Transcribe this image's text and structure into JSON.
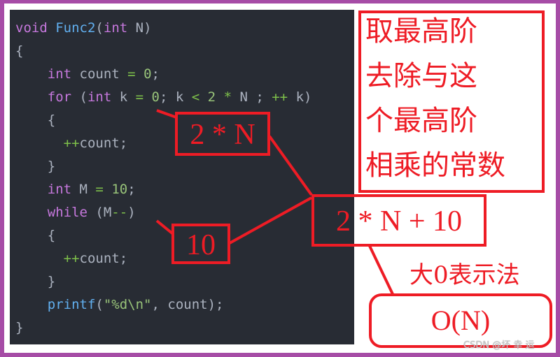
{
  "code": {
    "lines": [
      [
        {
          "t": "void",
          "c": "kw"
        },
        {
          "t": " "
        },
        {
          "t": "Func2",
          "c": "fn"
        },
        {
          "t": "("
        },
        {
          "t": "int",
          "c": "kw"
        },
        {
          "t": " N)"
        }
      ],
      [
        {
          "t": "{"
        }
      ],
      [
        {
          "t": "    "
        },
        {
          "t": "int",
          "c": "kw"
        },
        {
          "t": " count "
        },
        {
          "t": "=",
          "c": "op"
        },
        {
          "t": " "
        },
        {
          "t": "0",
          "c": "num"
        },
        {
          "t": ";"
        }
      ],
      [
        {
          "t": "    "
        },
        {
          "t": "for",
          "c": "kw"
        },
        {
          "t": " ("
        },
        {
          "t": "int",
          "c": "kw"
        },
        {
          "t": " k "
        },
        {
          "t": "=",
          "c": "op"
        },
        {
          "t": " "
        },
        {
          "t": "0",
          "c": "num"
        },
        {
          "t": "; k "
        },
        {
          "t": "<",
          "c": "op"
        },
        {
          "t": " "
        },
        {
          "t": "2",
          "c": "num"
        },
        {
          "t": " "
        },
        {
          "t": "*",
          "c": "op"
        },
        {
          "t": " N ; "
        },
        {
          "t": "++",
          "c": "op"
        },
        {
          "t": " k)"
        }
      ],
      [
        {
          "t": "    {"
        }
      ],
      [
        {
          "t": "      "
        },
        {
          "t": "++",
          "c": "op"
        },
        {
          "t": "count;"
        }
      ],
      [
        {
          "t": "    }"
        }
      ],
      [
        {
          "t": "    "
        },
        {
          "t": "int",
          "c": "kw"
        },
        {
          "t": " M "
        },
        {
          "t": "=",
          "c": "op"
        },
        {
          "t": " "
        },
        {
          "t": "10",
          "c": "num"
        },
        {
          "t": ";"
        }
      ],
      [
        {
          "t": "    "
        },
        {
          "t": "while",
          "c": "kw"
        },
        {
          "t": " (M"
        },
        {
          "t": "--",
          "c": "op"
        },
        {
          "t": ")"
        }
      ],
      [
        {
          "t": "    {"
        }
      ],
      [
        {
          "t": "      "
        },
        {
          "t": "++",
          "c": "op"
        },
        {
          "t": "count;"
        }
      ],
      [
        {
          "t": "    }"
        }
      ],
      [
        {
          "t": "    "
        },
        {
          "t": "printf",
          "c": "fn"
        },
        {
          "t": "("
        },
        {
          "t": "\"%d\\n\"",
          "c": "str"
        },
        {
          "t": ", count);"
        }
      ],
      [
        {
          "t": "}"
        }
      ]
    ]
  },
  "annotations": {
    "for_loop_count": "2 * N",
    "while_loop_count": "10",
    "total_count": "2 * N + 10",
    "rule_note_lines": [
      "取最高阶",
      "去除与这",
      "个最高阶",
      "相乘的常数"
    ],
    "notation_caption": "大0表示法",
    "result": "O(N)"
  },
  "colors": {
    "frame": "#a64ca6",
    "code_background": "#282c34",
    "annotation_red": "#ee1c25",
    "keyword": "#c678dd",
    "function": "#61afef",
    "number": "#98c379",
    "operator": "#7ec04a",
    "plain": "#abb2bf"
  },
  "watermark": "CSDN @坏 幸 运"
}
